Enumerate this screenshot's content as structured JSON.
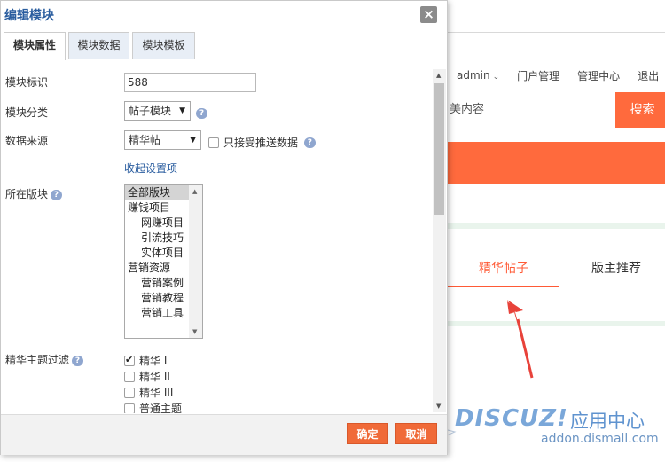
{
  "dialog": {
    "title": "编辑模块",
    "close_glyph": "×",
    "tabs": [
      {
        "label": "模块属性",
        "active": true
      },
      {
        "label": "模块数据",
        "active": false
      },
      {
        "label": "模块模板",
        "active": false
      }
    ],
    "fields": {
      "module_id": {
        "label": "模块标识",
        "value": "588"
      },
      "module_category": {
        "label": "模块分类",
        "value": "帖子模块"
      },
      "data_source": {
        "label": "数据来源",
        "value": "精华帖"
      },
      "push_only": {
        "label": "只接受推送数据",
        "checked": false
      },
      "collapse_link": "收起设置项",
      "forums": {
        "label": "所在版块",
        "options": [
          {
            "text": "全部版块",
            "selected": true,
            "indent": false
          },
          {
            "text": "赚钱项目",
            "selected": false,
            "indent": false
          },
          {
            "text": "网赚项目",
            "selected": false,
            "indent": true
          },
          {
            "text": "引流技巧",
            "selected": false,
            "indent": true
          },
          {
            "text": "实体项目",
            "selected": false,
            "indent": true
          },
          {
            "text": "营销资源",
            "selected": false,
            "indent": false
          },
          {
            "text": "营销案例",
            "selected": false,
            "indent": true
          },
          {
            "text": "营销教程",
            "selected": false,
            "indent": true
          },
          {
            "text": "营销工具",
            "selected": false,
            "indent": true
          }
        ]
      },
      "digest_filter": {
        "label": "精华主题过滤",
        "options": [
          {
            "text": "精华 I",
            "checked": true
          },
          {
            "text": "精华 II",
            "checked": false
          },
          {
            "text": "精华 III",
            "checked": false
          },
          {
            "text": "普通主题",
            "checked": false
          }
        ]
      }
    },
    "help_glyph": "?",
    "buttons": {
      "confirm": "确定",
      "cancel": "取消"
    }
  },
  "background": {
    "userbar": {
      "user": "admin",
      "portal": "门户管理",
      "admin_center": "管理中心",
      "logout": "退出"
    },
    "search": {
      "text": "美内容",
      "button": "搜索"
    },
    "tabs": {
      "active": "精华帖子",
      "other": "版主推荐"
    }
  },
  "watermark": {
    "logo": "DISCUZ!",
    "cn": "应用中心",
    "url": "addon.dismall.com"
  },
  "colors": {
    "accent": "#ff6a3d",
    "link": "#2a5d9f",
    "arrow": "#e8423a"
  }
}
